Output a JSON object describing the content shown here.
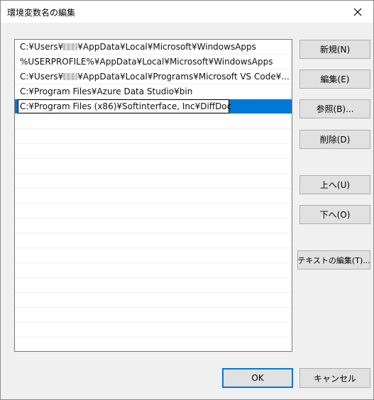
{
  "window": {
    "title": "環境変数名の編集"
  },
  "list": {
    "items": [
      {
        "prefix": "C:¥Users¥",
        "suffix": "¥AppData¥Local¥Microsoft¥WindowsApps",
        "redacted": true
      },
      {
        "prefix": "%USERPROFILE%¥AppData¥Local¥Microsoft¥WindowsApps",
        "suffix": "",
        "redacted": false
      },
      {
        "prefix": "C:¥Users¥",
        "suffix": "¥AppData¥Local¥Programs¥Microsoft VS Code¥...",
        "redacted": true
      },
      {
        "prefix": "C:¥Program Files¥Azure Data Studio¥bin",
        "suffix": "",
        "redacted": false
      }
    ],
    "editing_value": "C:¥Program Files (x86)¥Softinterface, Inc¥DiffDoc"
  },
  "buttons": {
    "new": "新規(N)",
    "edit": "編集(E)",
    "browse": "参照(B)...",
    "delete": "削除(D)",
    "move_up": "上へ(U)",
    "move_down": "下へ(O)",
    "edit_text": "テキストの編集(T)...",
    "ok": "OK",
    "cancel": "キャンセル"
  },
  "colors": {
    "selection": "#0078d7",
    "default_button_border": "#0078d7"
  }
}
